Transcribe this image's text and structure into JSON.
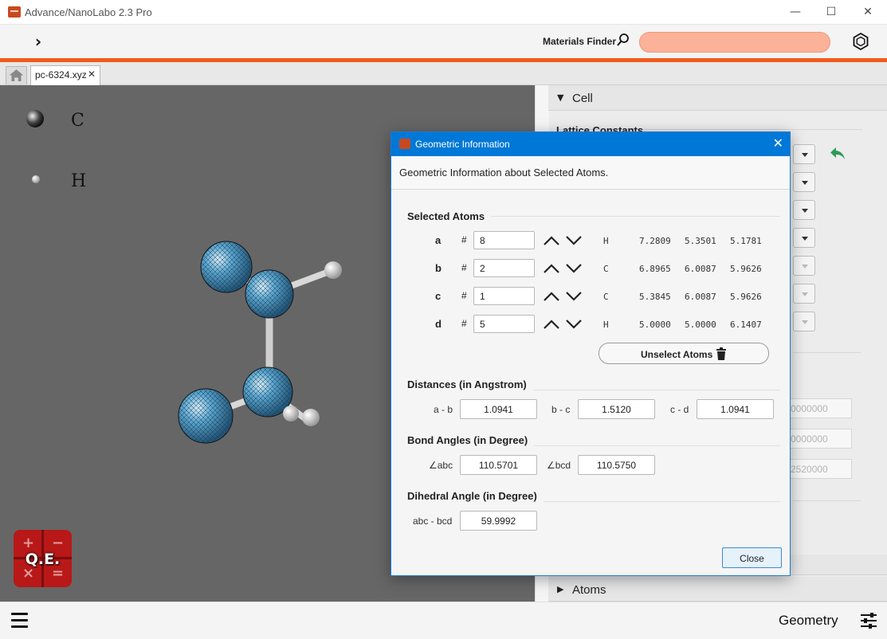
{
  "window": {
    "title": "Advance/NanoLabo 2.3 Pro",
    "minimize": "—",
    "maximize": "☐",
    "close": "✕"
  },
  "toolbar": {
    "expand": "›",
    "finder_label": "Materials Finder",
    "finder_value": ""
  },
  "tabs": {
    "file_tab": "pc-6324.xyz",
    "close": "✕"
  },
  "viewport": {
    "legend": [
      {
        "element": "C"
      },
      {
        "element": "H"
      }
    ],
    "qe_label": "Q.E.",
    "qe_symbols": [
      "+",
      "−",
      "×",
      "="
    ]
  },
  "right_panel": {
    "cell_header": "Cell",
    "lattice_label": "Lattice Constants",
    "field_values": [
      "0000000",
      "0000000",
      "2520000"
    ],
    "atoms_header": "Atoms"
  },
  "dialog": {
    "title": "Geometric Information",
    "header": "Geometric Information about Selected Atoms.",
    "selected_atoms_title": "Selected Atoms",
    "atoms": [
      {
        "label": "a",
        "hash": "#",
        "index": "8",
        "element": "H",
        "x": "7.2809",
        "y": "5.3501",
        "z": "5.1781"
      },
      {
        "label": "b",
        "hash": "#",
        "index": "2",
        "element": "C",
        "x": "6.8965",
        "y": "6.0087",
        "z": "5.9626"
      },
      {
        "label": "c",
        "hash": "#",
        "index": "1",
        "element": "C",
        "x": "5.3845",
        "y": "6.0087",
        "z": "5.9626"
      },
      {
        "label": "d",
        "hash": "#",
        "index": "5",
        "element": "H",
        "x": "5.0000",
        "y": "5.0000",
        "z": "6.1407"
      }
    ],
    "unselect_label": "Unselect Atoms",
    "distances_title": "Distances  (in Angstrom)",
    "distances": [
      {
        "label": "a - b",
        "value": "1.0941"
      },
      {
        "label": "b - c",
        "value": "1.5120"
      },
      {
        "label": "c - d",
        "value": "1.0941"
      }
    ],
    "bond_angles_title": "Bond Angles  (in Degree)",
    "bond_angles": [
      {
        "label": "∠abc",
        "value": "110.5701"
      },
      {
        "label": "∠bcd",
        "value": "110.5750"
      }
    ],
    "dihedral_title": "Dihedral Angle  (in Degree)",
    "dihedral": {
      "label": "abc - bcd",
      "value": "59.9992"
    },
    "close_label": "Close",
    "close_x": "✕"
  },
  "bottombar": {
    "mode_label": "Geometry"
  },
  "colors": {
    "accent": "#f25a1c",
    "finder_bg": "#fcb298",
    "dialog_title": "#0078d7",
    "viewport_bg": "#666666",
    "carbon_sphere": "#5aa6cf"
  },
  "icons": [
    "search-icon",
    "hexagon-icon",
    "home-icon",
    "undo-arrow-icon",
    "trash-icon",
    "hamburger-icon",
    "sliders-icon",
    "chevron-up-icon",
    "chevron-down-icon"
  ]
}
